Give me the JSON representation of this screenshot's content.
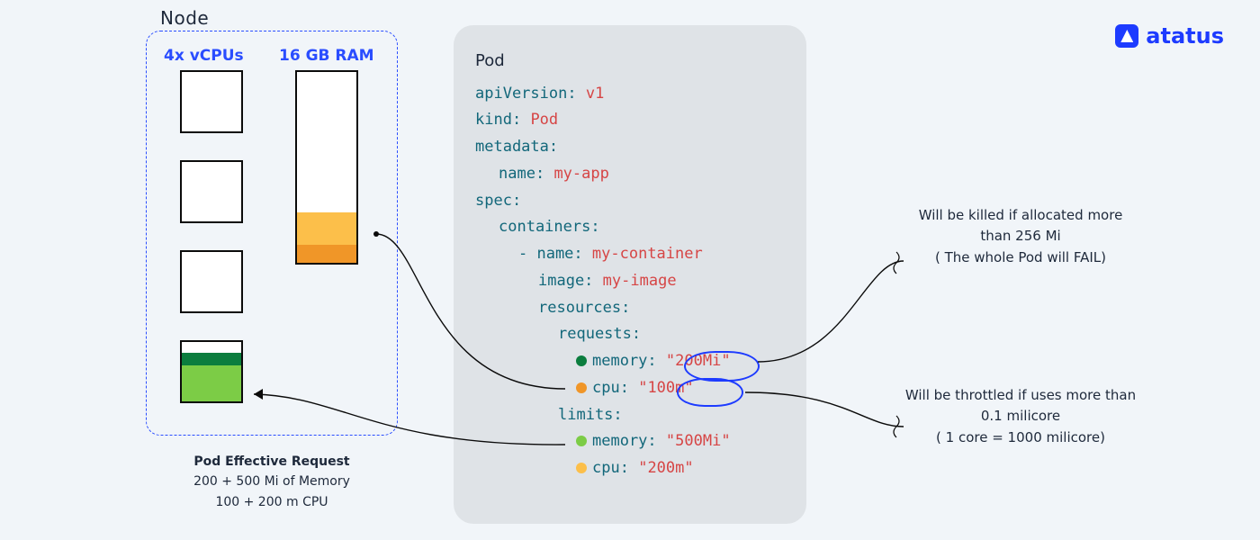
{
  "brand": {
    "name": "atatus"
  },
  "node": {
    "label": "Node",
    "cpu_label": "4x vCPUs",
    "ram_label": "16 GB RAM"
  },
  "effective": {
    "title": "Pod Effective Request",
    "line1": "200 + 500 Mi of Memory",
    "line2": "100 + 200 m CPU"
  },
  "pod": {
    "title": "Pod",
    "apiVersion_key": "apiVersion:",
    "apiVersion_val": "v1",
    "kind_key": "kind:",
    "kind_val": "Pod",
    "metadata_key": "metadata:",
    "name_key": "name:",
    "name_val": "my-app",
    "spec_key": "spec:",
    "containers_key": "containers:",
    "dash_name_key": "- name:",
    "dash_name_val": "my-container",
    "image_key": "image:",
    "image_val": "my-image",
    "resources_key": "resources:",
    "requests_key": "requests:",
    "req_mem_key": "memory:",
    "req_mem_val": "\"200Mi\"",
    "req_cpu_key": "cpu:",
    "req_cpu_val": "\"100m\"",
    "limits_key": "limits:",
    "lim_mem_key": "memory:",
    "lim_mem_val": "\"500Mi\"",
    "lim_cpu_key": "cpu:",
    "lim_cpu_val": "\"200m\""
  },
  "annotations": {
    "mem": "Will be killed if allocated more than 256 Mi\n( The whole Pod will FAIL)",
    "cpu": "Will be throttled if uses more than 0.1 milicore\n( 1 core = 1000 milicore)"
  },
  "colors": {
    "accent_blue": "#2a4dff",
    "yaml_key": "#12677a",
    "yaml_val": "#d64545",
    "green_dark": "#0b7d3e",
    "green_light": "#7ccc46",
    "orange_dark": "#f09628",
    "orange_light": "#fcbf4a"
  }
}
